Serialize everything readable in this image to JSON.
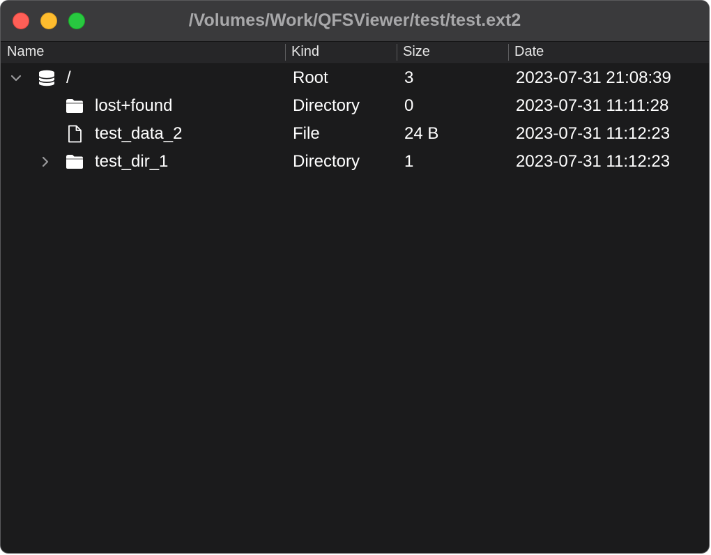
{
  "window": {
    "title": "/Volumes/Work/QFSViewer/test/test.ext2"
  },
  "columns": {
    "name": "Name",
    "kind": "Kind",
    "size": "Size",
    "date": "Date"
  },
  "rows": [
    {
      "name": "/",
      "kind": "Root",
      "size": "3",
      "date": "2023-07-31 21:08:39",
      "icon": "database-icon",
      "disclosure": "expanded"
    },
    {
      "name": "lost+found",
      "kind": "Directory",
      "size": "0",
      "date": "2023-07-31 11:11:28",
      "icon": "folder-icon",
      "disclosure": "none"
    },
    {
      "name": "test_data_2",
      "kind": "File",
      "size": "24 B",
      "date": "2023-07-31 11:12:23",
      "icon": "document-icon",
      "disclosure": "none"
    },
    {
      "name": "test_dir_1",
      "kind": "Directory",
      "size": "1",
      "date": "2023-07-31 11:12:23",
      "icon": "folder-icon",
      "disclosure": "collapsed"
    }
  ]
}
